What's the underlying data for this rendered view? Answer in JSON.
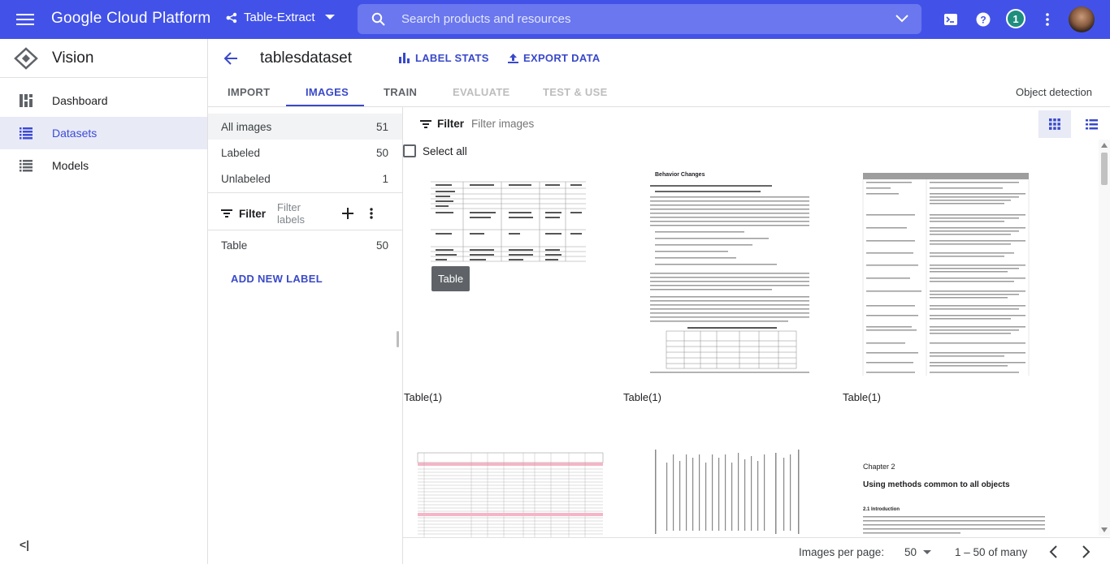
{
  "header": {
    "brand": "Google Cloud Platform",
    "project": "Table-Extract",
    "search_placeholder": "Search products and resources",
    "notification_count": "1"
  },
  "sidebar": {
    "product": "Vision",
    "items": [
      {
        "label": "Dashboard",
        "icon": "dashboard-icon"
      },
      {
        "label": "Datasets",
        "icon": "list-icon",
        "active": true
      },
      {
        "label": "Models",
        "icon": "list-icon"
      }
    ],
    "collapse_label": "<|"
  },
  "dataset": {
    "name": "tablesdataset",
    "label_stats": "LABEL STATS",
    "export_data": "EXPORT DATA"
  },
  "tabs": [
    {
      "label": "IMPORT",
      "state": "normal"
    },
    {
      "label": "IMAGES",
      "state": "active"
    },
    {
      "label": "TRAIN",
      "state": "normal"
    },
    {
      "label": "EVALUATE",
      "state": "disabled"
    },
    {
      "label": "TEST & USE",
      "state": "disabled"
    }
  ],
  "model_type": "Object detection",
  "left_panel": {
    "rows": [
      {
        "label": "All images",
        "count": "51"
      },
      {
        "label": "Labeled",
        "count": "50"
      },
      {
        "label": "Unlabeled",
        "count": "1"
      }
    ],
    "filter_label": "Filter",
    "filter_placeholder": "Filter labels",
    "labels": [
      {
        "label": "Table",
        "count": "50"
      }
    ],
    "add_label": "ADD NEW LABEL"
  },
  "images": {
    "filter_label": "Filter",
    "filter_placeholder": "Filter images",
    "select_all": "Select all",
    "tooltip": "Table",
    "captions": [
      "Table(1)",
      "Table(1)",
      "Table(1)"
    ],
    "doc_headings": {
      "behavior": "Behavior Changes",
      "chapter": "Chapter 2",
      "chapter_title": "Using methods common to all objects",
      "section": "2.1   Introduction"
    }
  },
  "footer": {
    "per_page_label": "Images per page:",
    "per_page_value": "50",
    "range": "1 – 50 of many"
  },
  "colors": {
    "topbar": "#4252e8",
    "accent": "#3949c9",
    "active_bg": "#e8eaf6"
  }
}
